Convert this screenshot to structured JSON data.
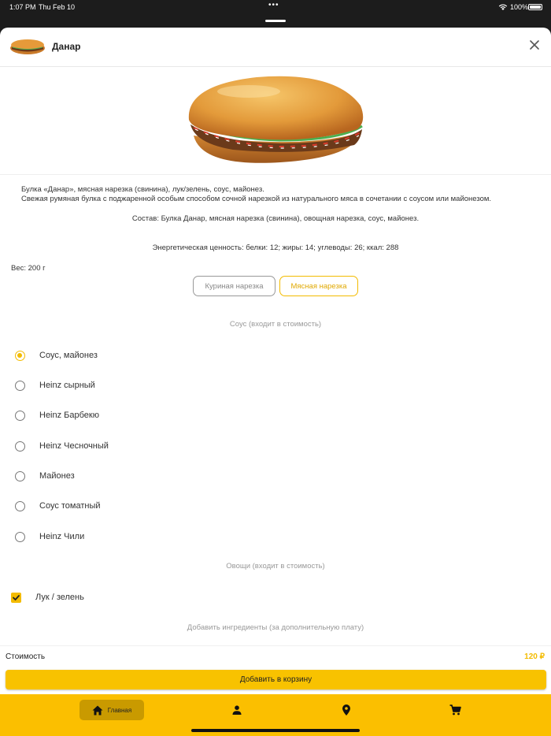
{
  "status_bar": {
    "time": "1:07 PM",
    "date": "Thu Feb 10",
    "battery": "100%"
  },
  "product": {
    "title": "Данар",
    "description_line1": "Булка «Данар», мясная нарезка (свинина), лук/зелень, соус, майонез.",
    "description_line2": "Свежая румяная булка с поджаренной особым способом сочной нарезкой из натурального мяса в сочетании с соусом или майонезом.",
    "composition": "Состав: Булка Данар, мясная нарезка (свинина), овощная нарезка, соус, майонез.",
    "energy": "Энергетическая ценность: белки: 12; жиры: 14; углеводы: 26; ккал: 288",
    "weight": "Вес: 200 г"
  },
  "variants": [
    {
      "label": "Куриная нарезка",
      "selected": false
    },
    {
      "label": "Мясная нарезка",
      "selected": true
    }
  ],
  "sauce_section": {
    "title": "Соус (входит в стоимость)",
    "options": [
      {
        "label": "Соус, майонез",
        "selected": true
      },
      {
        "label": "Heinz сырный",
        "selected": false
      },
      {
        "label": "Heinz Барбекю",
        "selected": false
      },
      {
        "label": "Heinz Чесночный",
        "selected": false
      },
      {
        "label": "Майонез",
        "selected": false
      },
      {
        "label": "Соус томатный",
        "selected": false
      },
      {
        "label": "Heinz Чили",
        "selected": false
      }
    ]
  },
  "vegetables_section": {
    "title": "Овощи (входит в стоимость)",
    "options": [
      {
        "label": "Лук / зелень",
        "checked": true
      }
    ]
  },
  "extras_section": {
    "title": "Добавить ингредиенты (за дополнительную плату)"
  },
  "footer": {
    "price_label": "Стоимость",
    "price_value": "120 ₽",
    "add_button": "Добавить в корзину"
  },
  "tabbar": {
    "home_label": "Главная",
    "icons": [
      "home-icon",
      "person-icon",
      "location-pin-icon",
      "cart-icon"
    ]
  },
  "colors": {
    "accent": "#f8c200",
    "tabbar": "#fbbf00",
    "tab_active": "#c99a00"
  }
}
